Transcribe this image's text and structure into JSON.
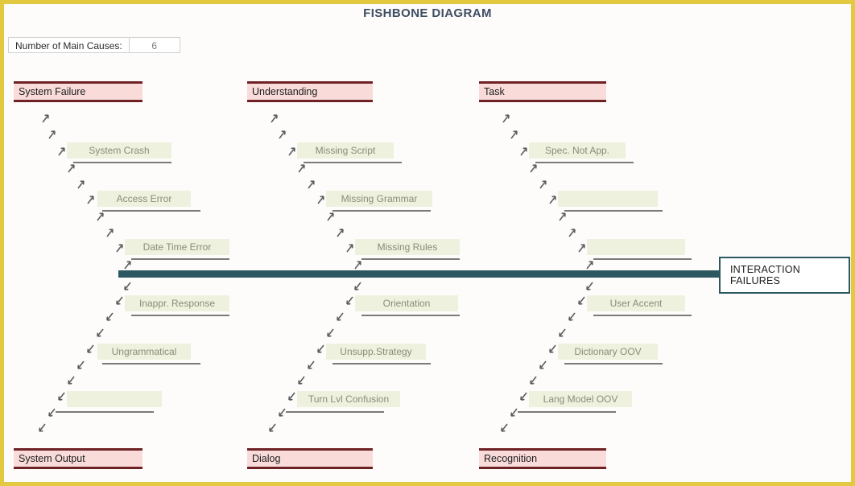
{
  "title": "FISHBONE DIAGRAM",
  "controls": {
    "causes_label": "Number of Main Causes:",
    "causes_value": "6"
  },
  "effect": {
    "label": "INTERACTION FAILURES"
  },
  "colors": {
    "frame": "#e3c93f",
    "spine": "#2d5861",
    "category_fill": "#f9dcda",
    "category_border": "#6e2225",
    "subcause_fill": "#eef1dd",
    "subcause_text": "#8a8c78",
    "title_text": "#3f4d63",
    "connector": "#7a7a7a"
  },
  "chart_data": {
    "type": "diagram",
    "diagram_kind": "fishbone",
    "effect": "INTERACTION FAILURES",
    "main_causes_count": 6,
    "categories": [
      {
        "name": "System Failure",
        "position": "top-left",
        "sub_causes": [
          "System Crash",
          "Access Error",
          "Date Time Error"
        ]
      },
      {
        "name": "Understanding",
        "position": "top-center",
        "sub_causes": [
          "Missing Script",
          "Missing Grammar",
          "Missing Rules"
        ]
      },
      {
        "name": "Task",
        "position": "top-right",
        "sub_causes": [
          "Spec. Not App.",
          "",
          ""
        ]
      },
      {
        "name": "System Output",
        "position": "bottom-left",
        "sub_causes": [
          "Inappr. Response",
          "Ungrammatical",
          ""
        ]
      },
      {
        "name": "Dialog",
        "position": "bottom-center",
        "sub_causes": [
          "Orientation",
          "Unsupp.Strategy",
          "Turn Lvl Confusion"
        ]
      },
      {
        "name": "Recognition",
        "position": "bottom-right",
        "sub_causes": [
          "User Accent",
          "Dictionary OOV",
          "Lang Model OOV"
        ]
      }
    ]
  },
  "categories": [
    {
      "label": "System Failure"
    },
    {
      "label": "Understanding"
    },
    {
      "label": "Task"
    },
    {
      "label": "System Output"
    },
    {
      "label": "Dialog"
    },
    {
      "label": "Recognition"
    }
  ],
  "subcauses": {
    "system_failure": [
      "System Crash",
      "Access Error",
      "Date Time Error"
    ],
    "understanding": [
      "Missing Script",
      "Missing Grammar",
      "Missing Rules"
    ],
    "task": [
      "Spec. Not App.",
      "",
      ""
    ],
    "system_output": [
      "Inappr. Response",
      "Ungrammatical",
      ""
    ],
    "dialog": [
      "Orientation",
      "Unsupp.Strategy",
      "Turn Lvl Confusion"
    ],
    "recognition": [
      "User Accent",
      "Dictionary OOV",
      "Lang Model OOV"
    ]
  }
}
